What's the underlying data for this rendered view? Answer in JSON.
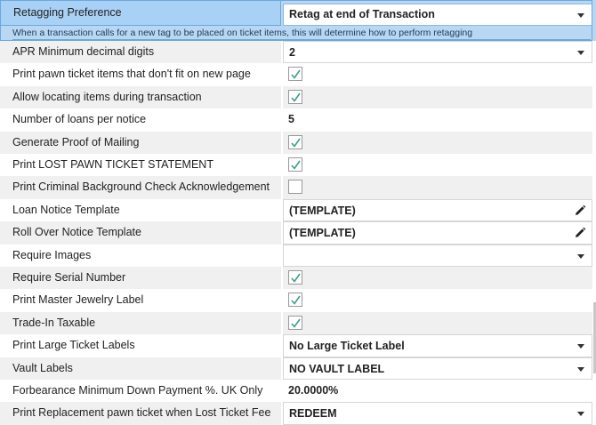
{
  "selected": {
    "label": "Retagging Preference",
    "value": "Retag at end of Transaction",
    "description": "When a transaction calls for a new tag to be placed on ticket items, this will determine how to perform retagging"
  },
  "rows": [
    {
      "label": "APR Minimum decimal digits",
      "value": "2",
      "type": "dropdown"
    },
    {
      "label": "Print pawn ticket items that don't fit on new page",
      "checked": true,
      "type": "checkbox"
    },
    {
      "label": "Allow locating items during transaction",
      "checked": true,
      "type": "checkbox"
    },
    {
      "label": "Number of loans per notice",
      "value": "5",
      "type": "text"
    },
    {
      "label": "Generate Proof of Mailing",
      "checked": true,
      "type": "checkbox"
    },
    {
      "label": "Print LOST PAWN TICKET STATEMENT",
      "checked": true,
      "type": "checkbox"
    },
    {
      "label": "Print Criminal Background Check Acknowledgement",
      "checked": false,
      "type": "checkbox"
    },
    {
      "label": "Loan Notice Template",
      "value": "(TEMPLATE)",
      "type": "editor"
    },
    {
      "label": "Roll Over Notice Template",
      "value": "(TEMPLATE)",
      "type": "editor"
    },
    {
      "label": "Require Images",
      "value": "",
      "type": "dropdown"
    },
    {
      "label": "Require Serial Number",
      "checked": true,
      "type": "checkbox"
    },
    {
      "label": "Print Master Jewelry Label",
      "checked": true,
      "type": "checkbox"
    },
    {
      "label": "Trade-In Taxable",
      "checked": true,
      "type": "checkbox"
    },
    {
      "label": "Print Large Ticket Labels",
      "value": "No Large Ticket Label",
      "type": "dropdown"
    },
    {
      "label": "Vault Labels",
      "value": "NO VAULT LABEL",
      "type": "dropdown"
    },
    {
      "label": "Forbearance Minimum Down Payment %. UK Only",
      "value": "20.0000%",
      "type": "text"
    },
    {
      "label": "Print Replacement pawn ticket when Lost Ticket Fee",
      "value": "REDEEM",
      "type": "dropdown"
    }
  ],
  "colors": {
    "selection": "#b9d7f2",
    "check": "#3f9c8c"
  },
  "icons": {
    "dropdown": "chevron-down-icon",
    "editor": "pencil-icon",
    "checkbox": "checkmark-icon"
  }
}
